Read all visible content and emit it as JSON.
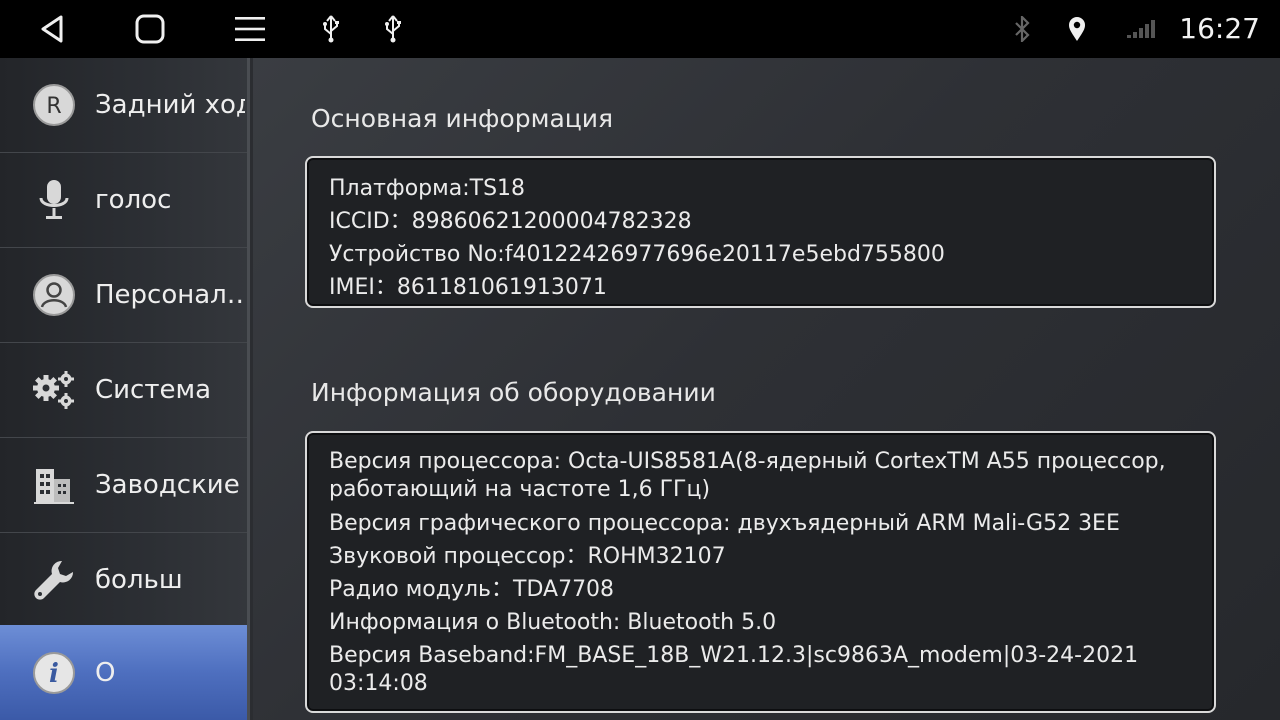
{
  "statusbar": {
    "time": "16:27",
    "icons": [
      "back-icon",
      "home-icon",
      "menu-icon",
      "usb-icon",
      "usb-icon",
      "bluetooth-icon",
      "location-icon",
      "signal-icon"
    ]
  },
  "sidebar": {
    "items": [
      {
        "label": "Задний ход",
        "icon": "reverse-r-icon"
      },
      {
        "label": "голос",
        "icon": "microphone-icon"
      },
      {
        "label": "Персонал…",
        "icon": "user-icon"
      },
      {
        "label": "Система",
        "icon": "gears-icon"
      },
      {
        "label": "Заводские",
        "icon": "factory-icon"
      },
      {
        "label": "больш",
        "icon": "wrench-icon"
      },
      {
        "label": "О",
        "icon": "info-icon"
      }
    ],
    "active_index": 6,
    "active_color": "#4e6fbf"
  },
  "main": {
    "basic": {
      "title": "Основная информация",
      "lines": [
        "Платформа:TS18",
        "ICCID：89860621200004782328",
        "Устройство No:f40122426977696e20117e5ebd755800",
        "IMEI：861181061913071"
      ]
    },
    "hardware": {
      "title": "Информация об оборудовании",
      "lines": [
        "Версия процессора:  Octa-UIS8581A(8-ядерный CortexTM A55 процессор, работающий на частоте 1,6 ГГц)",
        "Версия графического процессора: двухъядерный ARM Mali-G52 3EE",
        "Звуковой процессор：ROHM32107",
        "Радио модуль：TDA7708",
        "Информация о Bluetooth: Bluetooth 5.0",
        "Версия Baseband:FM_BASE_18B_W21.12.3|sc9863A_modem|03-24-2021 03:14:08"
      ]
    }
  }
}
